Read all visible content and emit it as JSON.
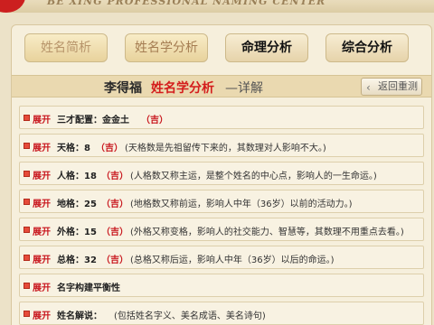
{
  "header": {
    "banner_text": "BE XING PROFESSIONAL NAMING CENTER"
  },
  "tabs": [
    {
      "label": "姓名简析"
    },
    {
      "label": "姓名学分析"
    },
    {
      "label": "命理分析"
    },
    {
      "label": "综合分析"
    }
  ],
  "title": {
    "name": "李得福",
    "analysis": "姓名学分析",
    "suffix": "—详解",
    "back_label": "返回重测"
  },
  "rows": [
    {
      "expand": "展开",
      "label": "三才配置：金金土",
      "luck": "（吉）",
      "desc": ""
    },
    {
      "expand": "展开",
      "label": "天格：8",
      "luck": "（吉）",
      "desc": "(天格数是先祖留传下来的，其数理对人影响不大。)"
    },
    {
      "expand": "展开",
      "label": "人格：18",
      "luck": "（吉）",
      "desc": "(人格数又称主运，是整个姓名的中心点，影响人的一生命运。)"
    },
    {
      "expand": "展开",
      "label": "地格：25",
      "luck": "（吉）",
      "desc": "(地格数又称前运，影响人中年（36岁）以前的活动力。)"
    },
    {
      "expand": "展开",
      "label": "外格：15",
      "luck": "（吉）",
      "desc": "(外格又称变格，影响人的社交能力、智慧等，其数理不用重点去看。)"
    },
    {
      "expand": "展开",
      "label": "总格：32",
      "luck": "（吉）",
      "desc": "(总格又称后运，影响人中年（36岁）以后的命运。)"
    },
    {
      "expand": "展开",
      "label": "名字构建平衡性",
      "luck": "",
      "desc": ""
    },
    {
      "expand": "展开",
      "label": "姓名解说：",
      "luck": "",
      "desc": "(包括姓名字义、美名成语、美名诗句)"
    }
  ],
  "colors": {
    "accent_red": "#c8151c",
    "panel_bg": "#f6efdc"
  }
}
